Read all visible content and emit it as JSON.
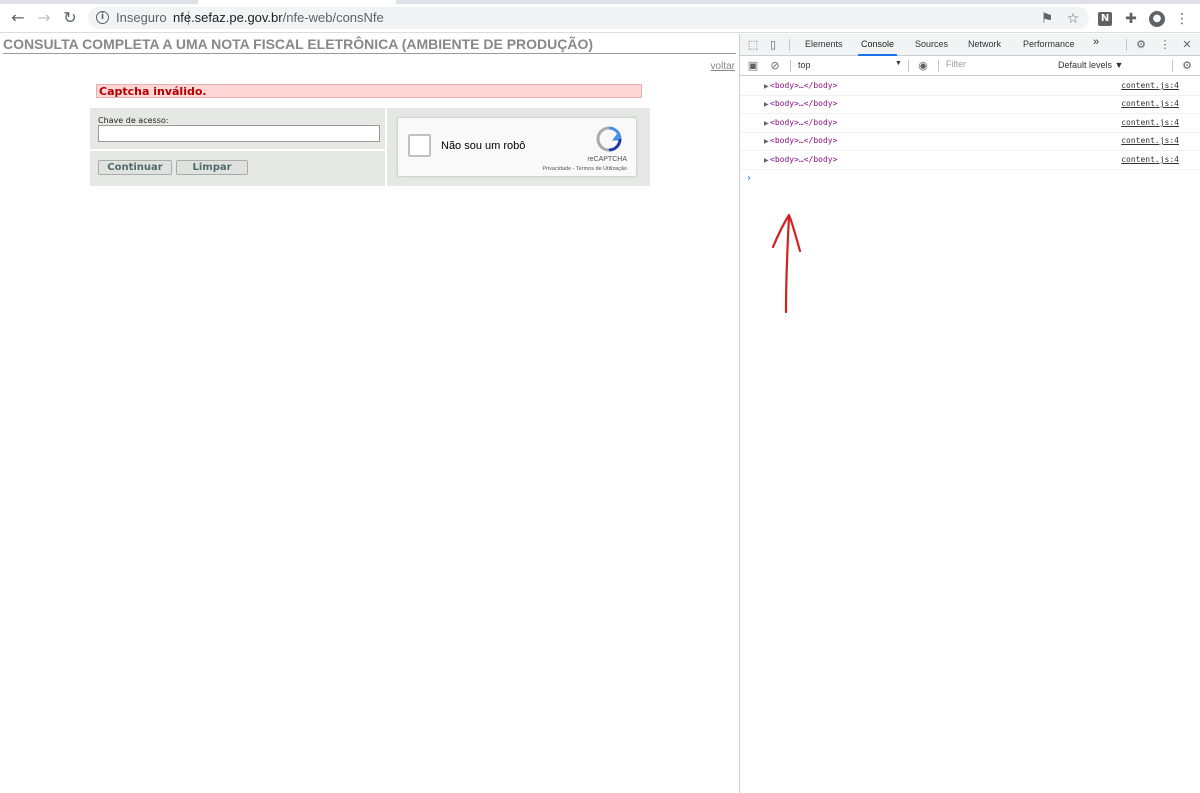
{
  "browser": {
    "security_label": "Inseguro",
    "url_host": "nfe.sefaz.pe.gov.br",
    "url_path": "/nfe-web/consNfe",
    "extension_n_label": "N"
  },
  "page": {
    "title": "CONSULTA COMPLETA A UMA NOTA FISCAL ELETRÔNICA (AMBIENTE DE PRODUÇÃO)",
    "back_link": "voltar",
    "error_message": "Captcha inválido.",
    "access_key_label": "Chave de acesso:",
    "access_key_value": "",
    "continue_button": "Continuar",
    "clear_button": "Limpar",
    "recaptcha": {
      "label": "Não sou um robô",
      "brand": "reCAPTCHA",
      "links": "Privacidade - Termos de Utilização"
    }
  },
  "devtools": {
    "tabs": [
      "Elements",
      "Console",
      "Sources",
      "Network",
      "Performance"
    ],
    "active_tab": "Console",
    "more_tabs": "»",
    "context": "top",
    "filter_placeholder": "Filter",
    "levels": "Default levels ▼",
    "logs": [
      {
        "code": "<body>…</body>",
        "source": "content.js:4"
      },
      {
        "code": "<body>…</body>",
        "source": "content.js:4"
      },
      {
        "code": "<body>…</body>",
        "source": "content.js:4"
      },
      {
        "code": "<body>…</body>",
        "source": "content.js:4"
      },
      {
        "code": "<body>…</body>",
        "source": "content.js:4"
      }
    ],
    "prompt": "›"
  },
  "colors": {
    "error_bg": "#ffd6d6",
    "error_text": "#b30000",
    "tab_accent": "#1a73e8",
    "annotation": "#d32020"
  }
}
